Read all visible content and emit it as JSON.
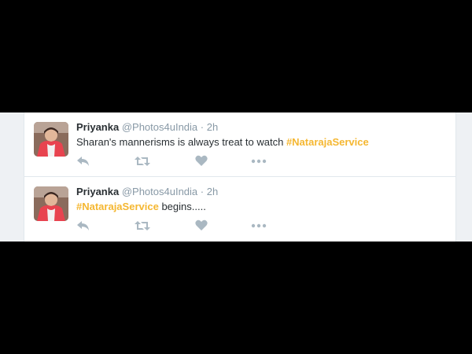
{
  "tweets": [
    {
      "name": "Priyanka",
      "handle": "@Photos4uIndia",
      "separator": "·",
      "time": "2h",
      "text": "Sharan's mannerisms is always treat to watch",
      "hashtag": "#NatarajaService",
      "text_after": ""
    },
    {
      "name": "Priyanka",
      "handle": "@Photos4uIndia",
      "separator": "·",
      "time": "2h",
      "text": "",
      "hashtag": "#NatarajaService",
      "text_after": "begins....."
    }
  ],
  "icons": {
    "reply": "reply-icon",
    "retweet": "retweet-icon",
    "like": "heart-icon",
    "more": "more-icon"
  },
  "colors": {
    "hashtag": "#f5b731",
    "muted": "#8899a6",
    "text": "#292f33",
    "icon": "#aab8c2"
  }
}
